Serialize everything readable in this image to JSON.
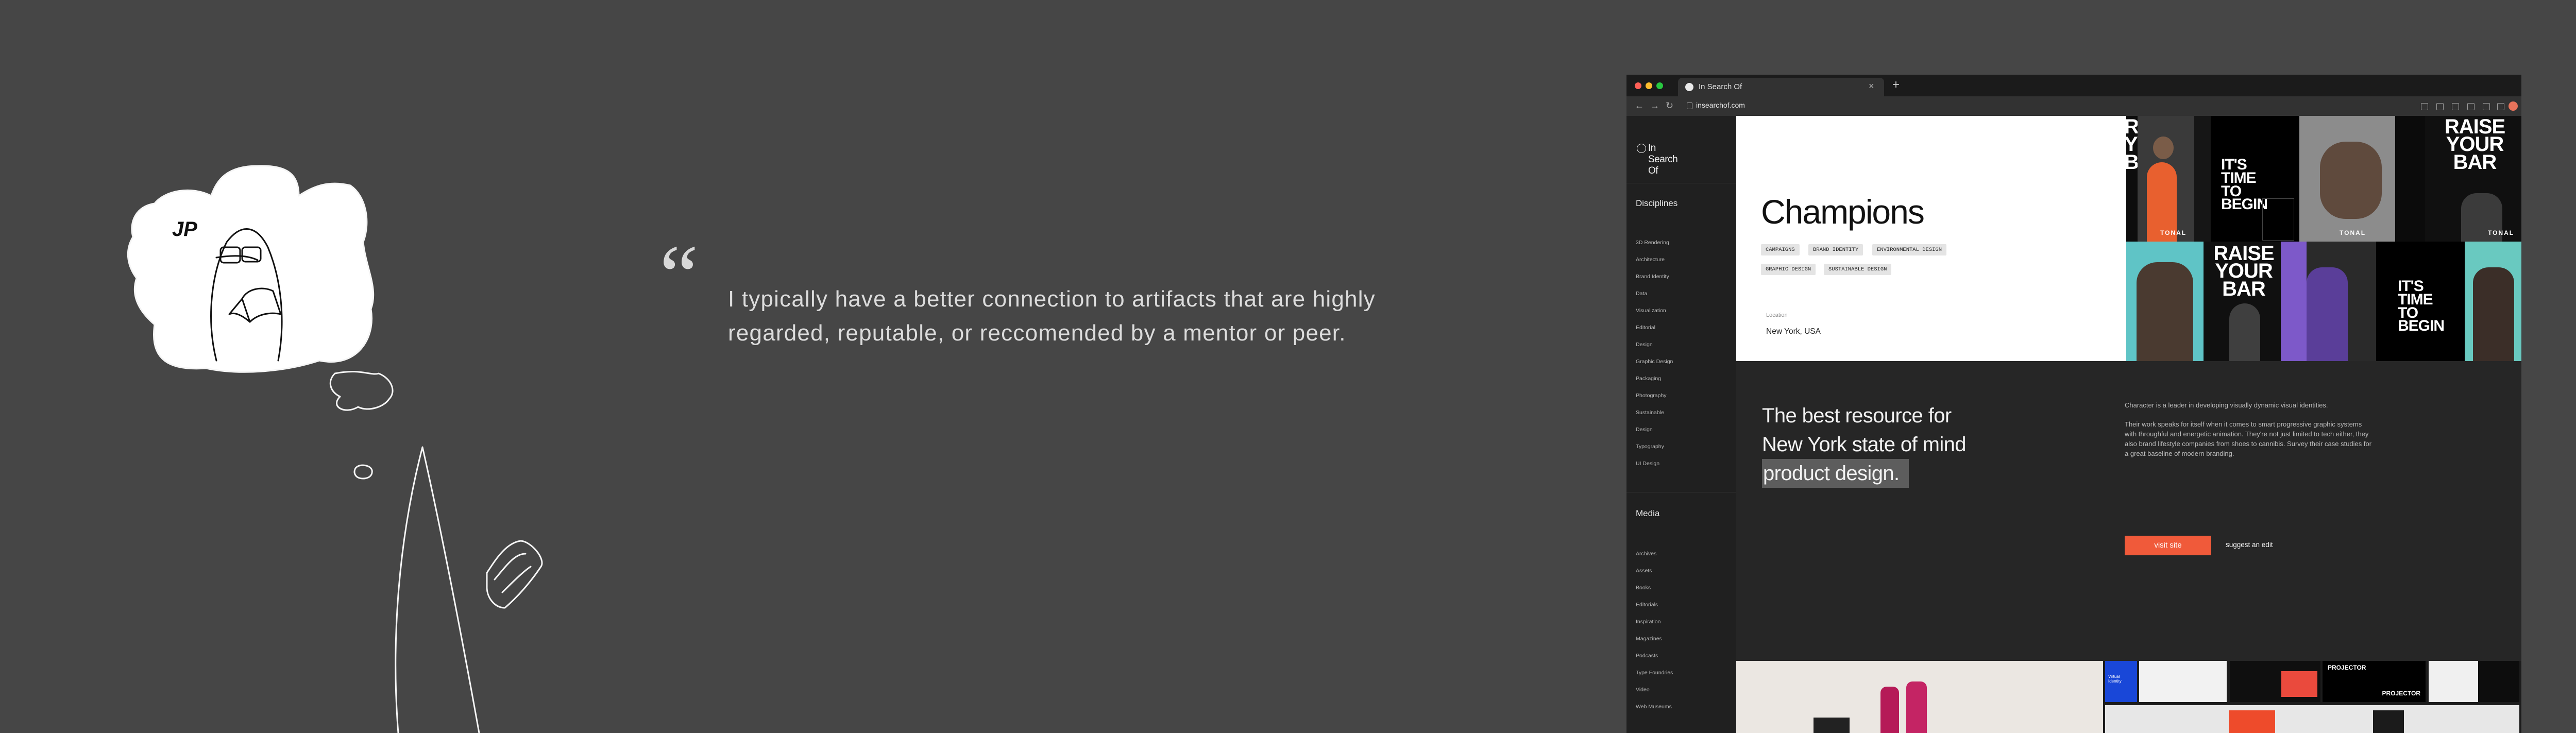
{
  "quote": {
    "mark": "“",
    "line1": "I typically have a better connection to artifacts that are highly",
    "line2": "regarded, reputable, or reccomended by a mentor or peer."
  },
  "illustration": {
    "badge": "JP"
  },
  "browser": {
    "tab_title": "In Search Of",
    "close": "×",
    "new_tab": "+",
    "url": "insearchof.com",
    "traffic_lights": [
      "#ff5f57",
      "#febc2e",
      "#28c840"
    ]
  },
  "site": {
    "logo": "In Search Of",
    "sidebar": {
      "disciplines_heading": "Disciplines",
      "disciplines": [
        "3D Rendering",
        "Architecture",
        "Brand Identity",
        "Data",
        "Visualization",
        "Editorial",
        "Design",
        "Graphic Design",
        "Packaging",
        "Photography",
        "Sustainable",
        "Design",
        "Typography",
        "UI Design"
      ],
      "media_heading": "Media",
      "media": [
        "Archives",
        "Assets",
        "Books",
        "Editorials",
        "Inspiration",
        "Magazines",
        "Podcasts",
        "Type Foundries",
        "Video",
        "Web Museums"
      ]
    },
    "hero": {
      "title": "Champions",
      "tags": [
        "CAMPAIGNS",
        "BRAND IDENTITY",
        "ENVIRONMENTAL DESIGN",
        "GRAPHIC DESIGN",
        "SUSTAINABLE DESIGN"
      ],
      "location_label": "Location",
      "location": "New York, USA"
    },
    "gallery": {
      "raise": "RAISE YOUR BAR",
      "time": "IT'S TIME TO BEGIN",
      "brand": "TONAL",
      "accent": "#f05a3a"
    },
    "band": {
      "tagline_1": "The best resource for",
      "tagline_2": "New York state of mind",
      "tagline_3": "product design.",
      "desc_1": "Character is a leader in developing visually dynamic visual identities.",
      "desc_2": "Their work speaks for itself when it comes to smart progressive graphic systems with throughful and energetic animation. They're not just limited to tech either, they also brand lifestyle companies from shoes to cannibis. Survey their case studies for a great baseline of modern branding.",
      "visit": "visit site",
      "suggest": "suggest an edit"
    },
    "thumbs": {
      "virtual": "Virtual Identity",
      "projector": "PROJECTOR"
    }
  }
}
